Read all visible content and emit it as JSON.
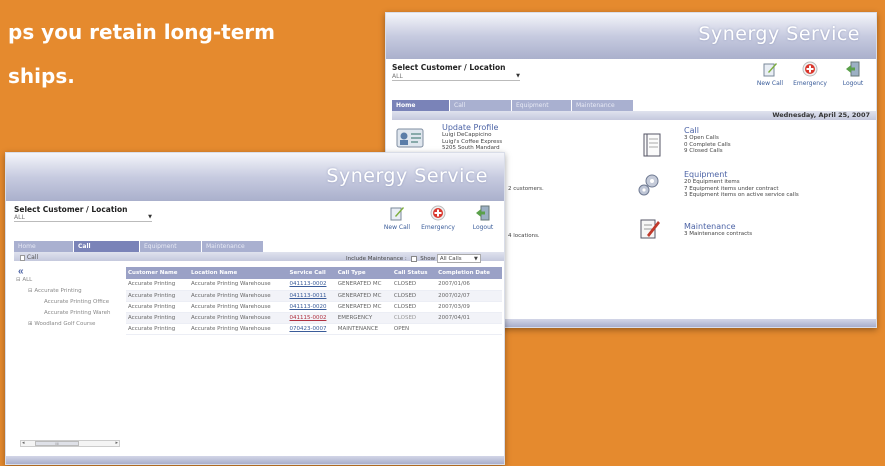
{
  "headline": {
    "line1": "ps you retain long-term",
    "line2": "ships."
  },
  "back_window": {
    "brand": "Synergy Service",
    "select_label": "Select Customer / Location",
    "select_value": "ALL",
    "tools": [
      {
        "label": "New Call",
        "icon": "new-call-icon"
      },
      {
        "label": "Emergency",
        "icon": "emergency-icon"
      },
      {
        "label": "Logout",
        "icon": "logout-icon"
      }
    ],
    "tabs": [
      {
        "label": "Home",
        "active": true
      },
      {
        "label": "Call",
        "active": false
      },
      {
        "label": "Equipment",
        "active": false
      },
      {
        "label": "Maintenance",
        "active": false
      }
    ],
    "date": "Wednesday, April 25, 2007",
    "update_profile": {
      "title": "Update Profile",
      "lines": [
        "Luigi DeCappicino",
        "Luigi's Coffee Express",
        "5205 South Mandard"
      ]
    },
    "customers_text": "2 customers.",
    "locations_text": "4 locations.",
    "call": {
      "title": "Call",
      "lines": [
        "3  Open Calls",
        "0  Complete Calls",
        "9  Closed Calls"
      ]
    },
    "equipment": {
      "title": "Equipment",
      "lines": [
        "20  Equipment items",
        "7  Equipment items under contract",
        "3  Equipment items on active service calls"
      ]
    },
    "maintenance": {
      "title": "Maintenance",
      "lines": [
        "3  Maintenance contracts"
      ]
    }
  },
  "front_window": {
    "brand": "Synergy Service",
    "select_label": "Select Customer / Location",
    "select_value": "ALL",
    "tools": [
      {
        "label": "New Call",
        "icon": "new-call-icon"
      },
      {
        "label": "Emergency",
        "icon": "emergency-icon"
      },
      {
        "label": "Logout",
        "icon": "logout-icon"
      }
    ],
    "tabs": [
      {
        "label": "Home",
        "active": false
      },
      {
        "label": "Call",
        "active": true
      },
      {
        "label": "Equipment",
        "active": false
      },
      {
        "label": "Maintenance",
        "active": false
      }
    ],
    "breadcrumb": "Call",
    "include_maintenance_label": "Include Maintenance :",
    "show_label": "Show",
    "show_value": "All Calls",
    "tree": [
      {
        "label": "ALL",
        "level": 0
      },
      {
        "label": "Accurate Printing",
        "level": 1
      },
      {
        "label": "Accurate Printing Office",
        "level": 2
      },
      {
        "label": "Accurate Printing Wareh",
        "level": 2
      },
      {
        "label": "Woodland Golf Course",
        "level": 1
      }
    ],
    "table": {
      "headers": [
        "Customer Name",
        "Location Name",
        "Service Call",
        "Call Type",
        "Call Status",
        "Completion Date"
      ],
      "rows": [
        [
          "Accurate Printing",
          "Accurate Printing Warehouse",
          "041113-0002",
          "GENERATED MC",
          "CLOSED",
          "2007/01/06"
        ],
        [
          "Accurate Printing",
          "Accurate Printing Warehouse",
          "041113-0011",
          "GENERATED MC",
          "CLOSED",
          "2007/02/07"
        ],
        [
          "Accurate Printing",
          "Accurate Printing Warehouse",
          "041113-0020",
          "GENERATED MC",
          "CLOSED",
          "2007/03/09"
        ],
        [
          "Accurate Printing",
          "Accurate Printing Warehouse",
          "041115-0002",
          "EMERGENCY",
          "CLOSED",
          "2007/04/01"
        ],
        [
          "Accurate Printing",
          "Accurate Printing Warehouse",
          "070423-0007",
          "MAINTENANCE",
          "OPEN",
          ""
        ]
      ]
    },
    "scroll_label": "III"
  }
}
